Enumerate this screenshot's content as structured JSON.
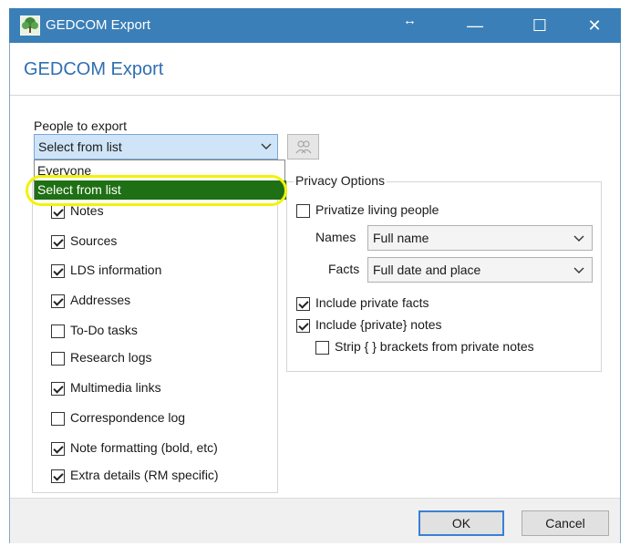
{
  "window": {
    "title": "GEDCOM Export",
    "resize_glyph": "↔",
    "min_glyph": "—",
    "max_glyph": "☐",
    "close_glyph": "✕"
  },
  "header": {
    "title": "GEDCOM Export"
  },
  "people": {
    "label": "People to export",
    "selected": "Select from list",
    "options": [
      "Everyone",
      "Select from list"
    ]
  },
  "include": [
    {
      "label": "Notes",
      "checked": true
    },
    {
      "label": "Sources",
      "checked": true
    },
    {
      "label": "LDS information",
      "checked": true
    },
    {
      "label": "Addresses",
      "checked": true
    },
    {
      "label": "To-Do tasks",
      "checked": false
    },
    {
      "label": "Research logs",
      "checked": false
    },
    {
      "label": "Multimedia links",
      "checked": true
    },
    {
      "label": "Correspondence log",
      "checked": false
    },
    {
      "label": "Note formatting (bold, etc)",
      "checked": true
    },
    {
      "label": "Extra details (RM specific)",
      "checked": true
    }
  ],
  "privacy": {
    "title": "Privacy Options",
    "privatize_living": {
      "label": "Privatize living people",
      "checked": false
    },
    "names_label": "Names",
    "names_value": "Full name",
    "facts_label": "Facts",
    "facts_value": "Full date and place",
    "include_private_facts": {
      "label": "Include private facts",
      "checked": true
    },
    "include_private_notes": {
      "label": "Include {private} notes",
      "checked": true
    },
    "strip_brackets": {
      "label": "Strip { } brackets from private notes",
      "checked": false
    }
  },
  "footer": {
    "ok_label": "OK",
    "cancel_label": "Cancel"
  },
  "colors": {
    "titlebar": "#3b7fb8",
    "header_text": "#2f6fb0",
    "selection": "#1f6f14",
    "highlight": "#f2f20a"
  }
}
